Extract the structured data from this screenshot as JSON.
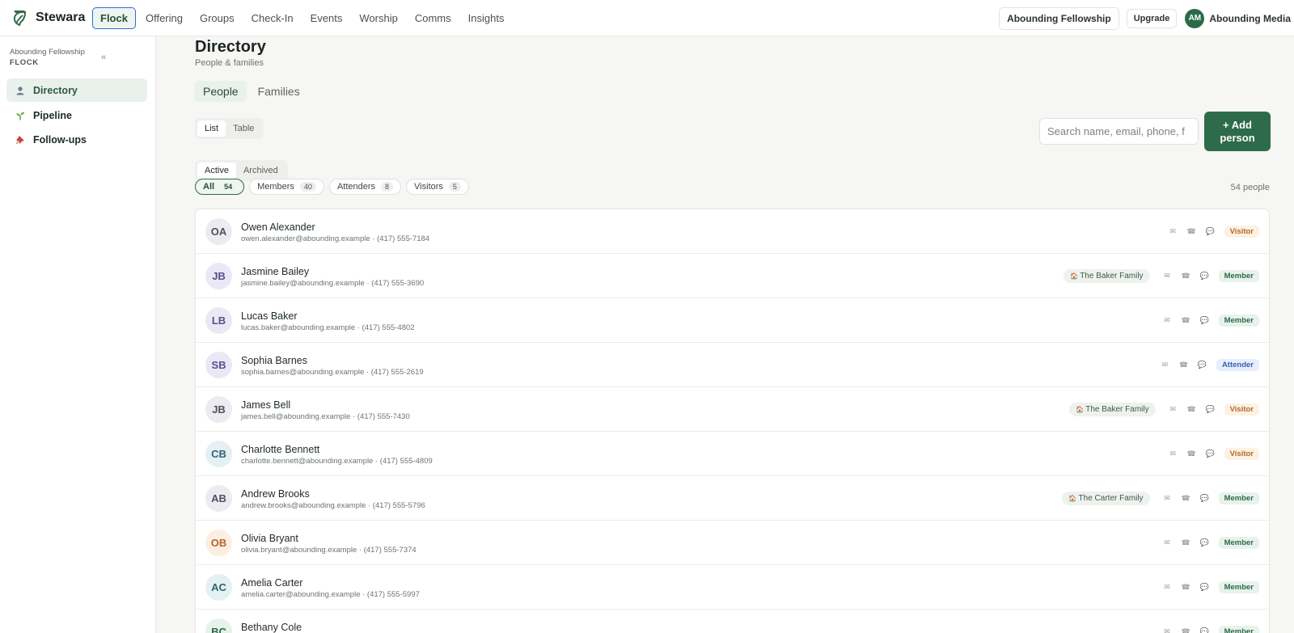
{
  "brand": {
    "name": "Stewara"
  },
  "nav": [
    "Flock",
    "Offering",
    "Groups",
    "Check-In",
    "Events",
    "Worship",
    "Comms",
    "Insights"
  ],
  "top_right": {
    "org": "Abounding Fellowship",
    "upgrade": "Upgrade",
    "initials": "AM",
    "user": "Abounding Media"
  },
  "sidebar": {
    "org": "Abounding Fellowship",
    "section": "FLOCK",
    "collapse": "«",
    "items": [
      {
        "label": "Directory",
        "icon": "person-icon"
      },
      {
        "label": "Pipeline",
        "icon": "sprout-icon"
      },
      {
        "label": "Follow-ups",
        "icon": "pushpin-icon"
      }
    ]
  },
  "page": {
    "title": "Directory",
    "subtitle": "People & families"
  },
  "tabs": [
    "People",
    "Families"
  ],
  "view_toggle": [
    "List",
    "Table"
  ],
  "state_toggle": [
    "Active",
    "Archived"
  ],
  "search": {
    "placeholder": "Search name, email, phone, f"
  },
  "add_button": "+ Add person",
  "filters": [
    {
      "label": "All",
      "count": "54"
    },
    {
      "label": "Members",
      "count": "40"
    },
    {
      "label": "Attenders",
      "count": "8"
    },
    {
      "label": "Visitors",
      "count": "5"
    }
  ],
  "people_count": "54 people",
  "colors": {
    "accent": "#2e6b4a",
    "visitor_bg": "#fdf1e4",
    "visitor_fg": "#b4672a",
    "member_bg": "#e8f2ec",
    "member_fg": "#2e6b4a",
    "attender_bg": "#e7eefb",
    "attender_fg": "#3a5fb0"
  },
  "people": [
    {
      "initials": "OA",
      "name": "Owen Alexander",
      "email": "owen.alexander@abounding.example",
      "phone": "(417) 555-7184",
      "family": "",
      "status": "Visitor",
      "avatar_bg": "#ececf0",
      "avatar_fg": "#4b5160"
    },
    {
      "initials": "JB",
      "name": "Jasmine Bailey",
      "email": "jasmine.bailey@abounding.example",
      "phone": "(417) 555-3690",
      "family": "The Baker Family",
      "status": "Member",
      "avatar_bg": "#ebe8f5",
      "avatar_fg": "#5a4f8a"
    },
    {
      "initials": "LB",
      "name": "Lucas Baker",
      "email": "lucas.baker@abounding.example",
      "phone": "(417) 555-4802",
      "family": "",
      "status": "Member",
      "avatar_bg": "#ebe8f5",
      "avatar_fg": "#5a4f8a"
    },
    {
      "initials": "SB",
      "name": "Sophia Barnes",
      "email": "sophia.barnes@abounding.example",
      "phone": "(417) 555-2619",
      "family": "",
      "status": "Attender",
      "avatar_bg": "#ebe8f5",
      "avatar_fg": "#5a4f8a"
    },
    {
      "initials": "JB",
      "name": "James Bell",
      "email": "james.bell@abounding.example",
      "phone": "(417) 555-7430",
      "family": "The Baker Family",
      "status": "Visitor",
      "avatar_bg": "#ececf0",
      "avatar_fg": "#4b5160"
    },
    {
      "initials": "CB",
      "name": "Charlotte Bennett",
      "email": "charlotte.bennett@abounding.example",
      "phone": "(417) 555-4809",
      "family": "",
      "status": "Visitor",
      "avatar_bg": "#e4f0f3",
      "avatar_fg": "#2c6672"
    },
    {
      "initials": "AB",
      "name": "Andrew Brooks",
      "email": "andrew.brooks@abounding.example",
      "phone": "(417) 555-5796",
      "family": "The Carter Family",
      "status": "Member",
      "avatar_bg": "#ececf0",
      "avatar_fg": "#4b5160"
    },
    {
      "initials": "OB",
      "name": "Olivia Bryant",
      "email": "olivia.bryant@abounding.example",
      "phone": "(417) 555-7374",
      "family": "",
      "status": "Member",
      "avatar_bg": "#fcefe2",
      "avatar_fg": "#b4672a"
    },
    {
      "initials": "AC",
      "name": "Amelia Carter",
      "email": "amelia.carter@abounding.example",
      "phone": "(417) 555-5997",
      "family": "",
      "status": "Member",
      "avatar_bg": "#e4f0f3",
      "avatar_fg": "#2c6672"
    },
    {
      "initials": "BC",
      "name": "Bethany Cole",
      "email": "",
      "phone": "",
      "family": "",
      "status": "Member",
      "avatar_bg": "#e6f2ea",
      "avatar_fg": "#2e6b4a"
    }
  ]
}
